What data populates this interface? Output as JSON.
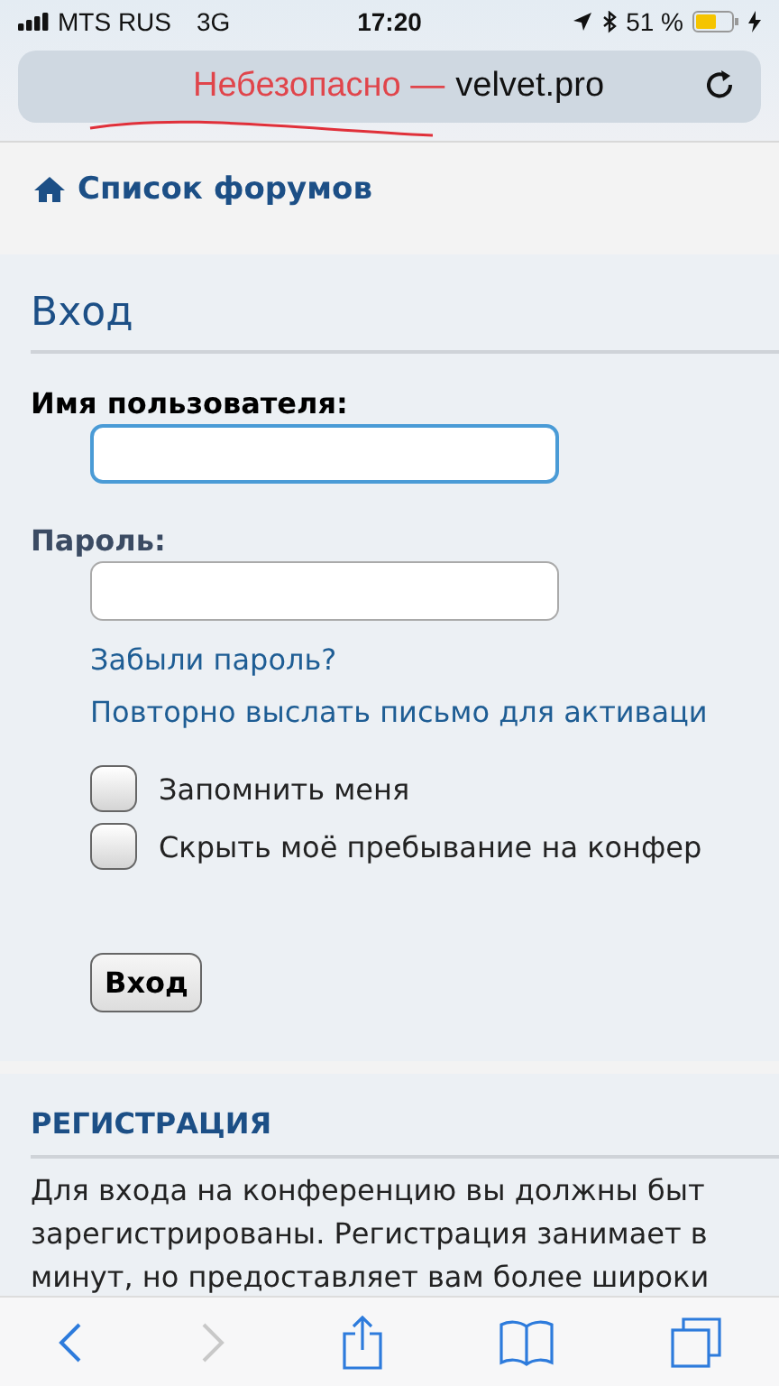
{
  "status_bar": {
    "carrier": "MTS RUS",
    "network": "3G",
    "time": "17:20",
    "battery": "51 %"
  },
  "address_bar": {
    "warning": "Небезопасно —",
    "domain": "velvet.pro"
  },
  "breadcrumb": "Список форумов",
  "login": {
    "title": "Вход",
    "fields": [
      {
        "label": "Имя пользователя:",
        "focused": true
      },
      {
        "label": "Пароль:",
        "focused": false
      }
    ],
    "links": [
      "Забыли пароль?",
      "Повторно выслать письмо для активаци"
    ],
    "checkboxes": [
      {
        "label": "Запомнить меня",
        "checked": false
      },
      {
        "label": "Скрыть моё пребывание на конфер",
        "checked": false
      }
    ],
    "button": "Вход"
  },
  "registration": {
    "title": "РЕГИСТРАЦИЯ",
    "lines": [
      "Для входа на конференцию вы должны быт",
      "зарегистрированы. Регистрация занимает в",
      "минут, но предоставляет вам более широки"
    ]
  },
  "toolbar": {
    "forward_disabled": true
  }
}
